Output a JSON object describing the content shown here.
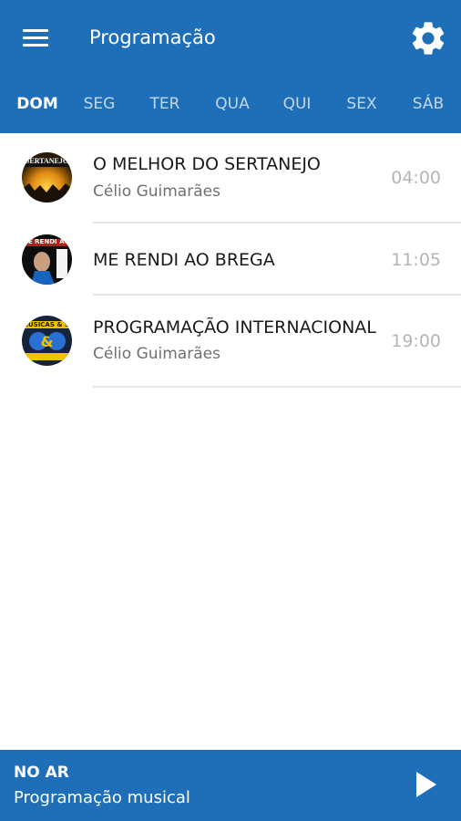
{
  "app_bar": {
    "title": "Programação",
    "menu_icon": "menu-icon",
    "settings_icon": "gear-icon",
    "background": "#1e6fb8"
  },
  "tabs": [
    {
      "label": "DOM",
      "active": true
    },
    {
      "label": "SEG",
      "active": false
    },
    {
      "label": "TER",
      "active": false
    },
    {
      "label": "QUA",
      "active": false
    },
    {
      "label": "QUI",
      "active": false
    },
    {
      "label": "SEX",
      "active": false
    },
    {
      "label": "SÁB",
      "active": false
    }
  ],
  "schedule": [
    {
      "title": "O MELHOR DO SERTANEJO",
      "host": "Célio Guimarães",
      "time": "04:00",
      "thumbnail_text": "SERTANEJO"
    },
    {
      "title": "ME RENDI AO BREGA",
      "host": "",
      "time": "11:05",
      "thumbnail_text": "ME RENDI AO BREGA"
    },
    {
      "title": "PROGRAMAÇÃO INTERNACIONAL",
      "host": "Célio Guimarães",
      "time": "19:00",
      "thumbnail_text": "MÚSICAS & SAUDADES"
    }
  ],
  "player": {
    "label": "NO AR",
    "now_playing": "Programação musical",
    "play_icon": "play-icon"
  }
}
